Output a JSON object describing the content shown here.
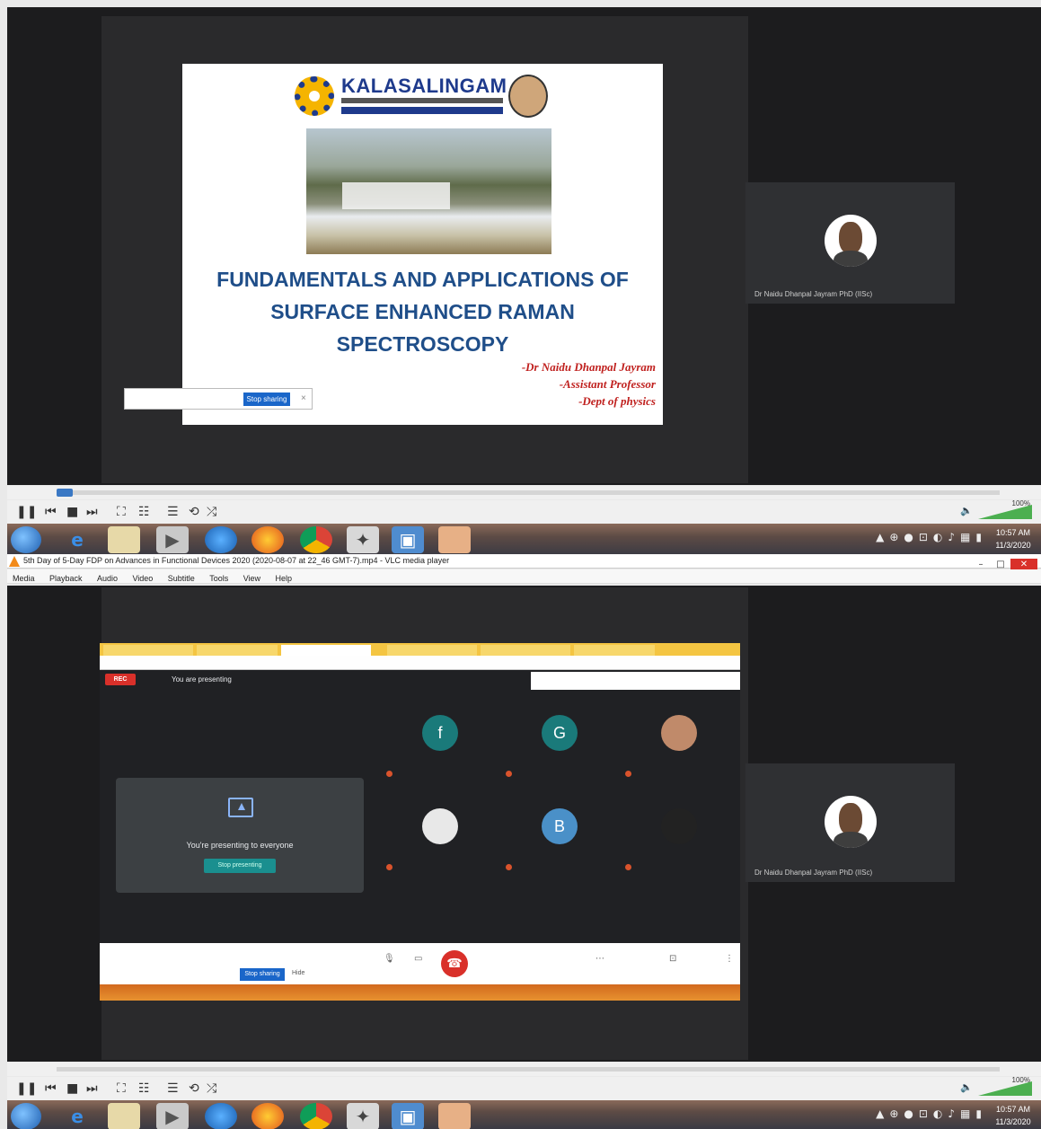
{
  "slide": {
    "logo_title": "KALASALINGAM",
    "title_lines": [
      "FUNDAMENTALS AND APPLICATIONS OF",
      "SURFACE ENHANCED RAMAN",
      "SPECTROSCOPY"
    ],
    "author_lines": [
      "-Dr Naidu Dhanpal Jayram",
      "-Assistant Professor",
      "-Dept of physics"
    ]
  },
  "share_bar": {
    "stop_label": "Stop sharing"
  },
  "participant_camera": {
    "name": "Dr Naidu Dhanpal Jayram PhD (IISc)"
  },
  "vlc": {
    "window_title": "5th Day of 5-Day FDP on Advances in Functional Devices 2020 (2020-08-07 at 22_46 GMT-7).mp4 - VLC media player",
    "menu": [
      "Media",
      "Playback",
      "Audio",
      "Video",
      "Subtitle",
      "Tools",
      "View",
      "Help"
    ],
    "volume": "100%"
  },
  "taskbar": {
    "time": "10:57 AM",
    "date": "11/3/2020"
  },
  "meet": {
    "rec_label": "REC",
    "presenting_label": "You are presenting",
    "present_card_text": "You're presenting to everyone",
    "stop_presenting_label": "Stop presenting",
    "participants": [
      {
        "initial": "f",
        "color": "#1a7a7a"
      },
      {
        "initial": "G",
        "color": "#1a7a7a"
      },
      {
        "initial": "",
        "color": "#c08a6a"
      },
      {
        "initial": "",
        "color": "#e8e8e8"
      },
      {
        "initial": "B",
        "color": "#4a90c8"
      },
      {
        "initial": "",
        "color": "#222222"
      }
    ],
    "bottom": {
      "hide_label": "Hide"
    }
  }
}
